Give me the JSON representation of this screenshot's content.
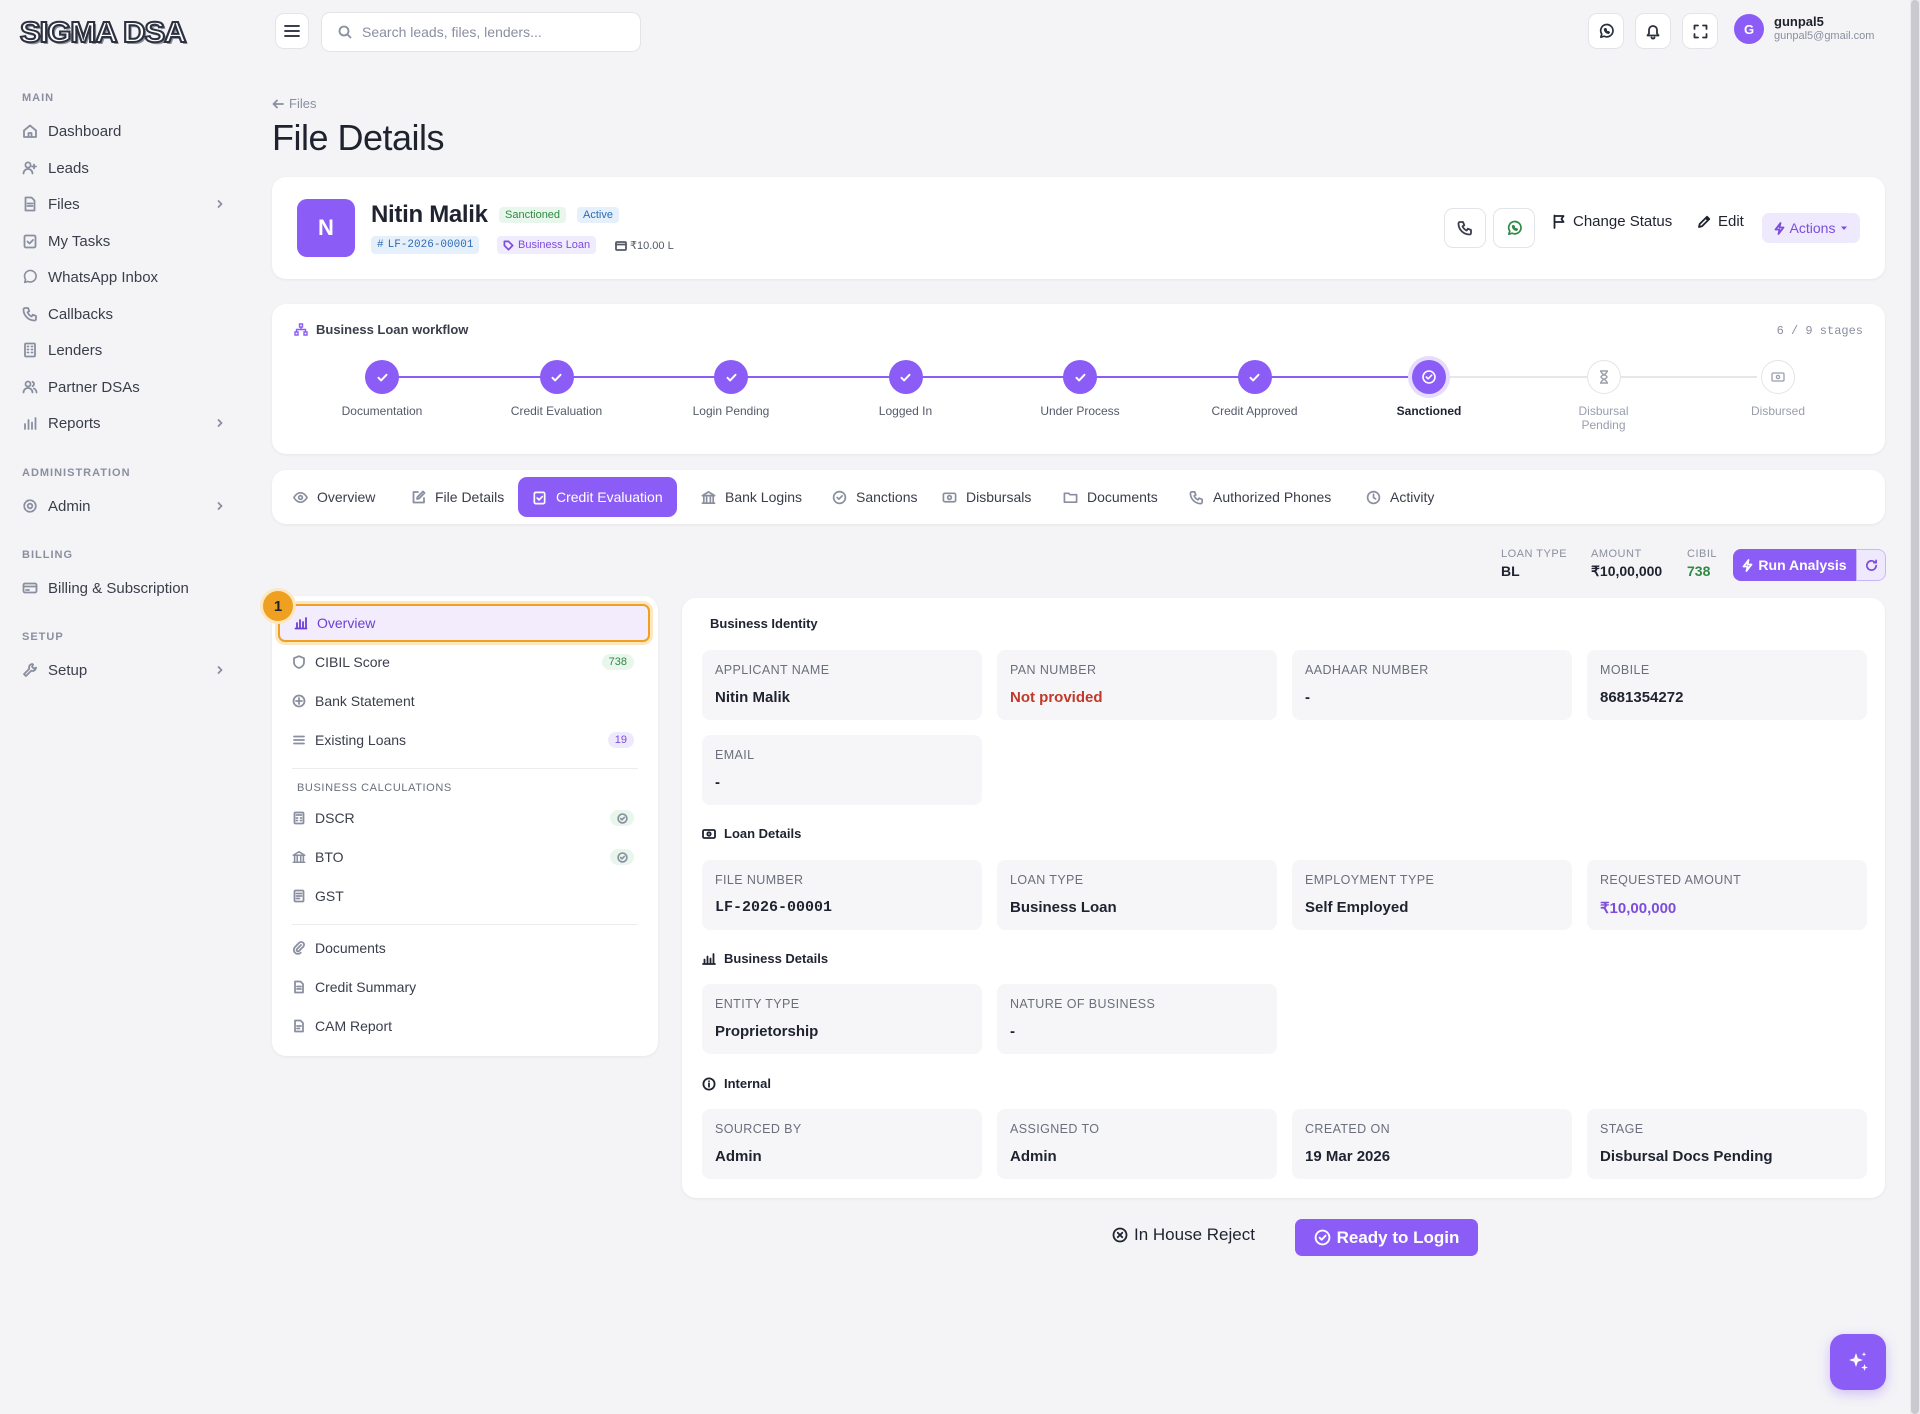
{
  "app": {
    "logo": "SIGMA DSA"
  },
  "topbar": {
    "search_placeholder": "Search leads, files, lenders...",
    "user": {
      "initial": "G",
      "name": "gunpal5",
      "email": "gunpal5@gmail.com"
    }
  },
  "sidebar": {
    "sections": {
      "main": "MAIN",
      "administration": "ADMINISTRATION",
      "billing": "BILLING",
      "setup": "SETUP"
    },
    "items": [
      {
        "label": "Dashboard",
        "icon": "home-icon"
      },
      {
        "label": "Leads",
        "icon": "user-plus-icon"
      },
      {
        "label": "Files",
        "icon": "file-icon"
      },
      {
        "label": "My Tasks",
        "icon": "clipboard-check-icon"
      },
      {
        "label": "WhatsApp Inbox",
        "icon": "whatsapp-icon"
      },
      {
        "label": "Callbacks",
        "icon": "phone-icon"
      },
      {
        "label": "Lenders",
        "icon": "building-icon"
      },
      {
        "label": "Partner DSAs",
        "icon": "users-icon"
      },
      {
        "label": "Reports",
        "icon": "bar-chart-icon"
      },
      {
        "label": "Admin",
        "icon": "gear-icon"
      },
      {
        "label": "Billing & Subscription",
        "icon": "credit-card-icon"
      },
      {
        "label": "Setup",
        "icon": "wrench-icon"
      }
    ]
  },
  "page": {
    "breadcrumb": "Files",
    "title": "File Details"
  },
  "applicant": {
    "initial": "N",
    "name": "Nitin Malik",
    "status_badge": "Sanctioned",
    "state_badge": "Active",
    "file_number": "LF-2026-00001",
    "loan_type": "Business Loan",
    "amount": "₹10.00 L",
    "actions": {
      "change_status": "Change Status",
      "edit": "Edit",
      "actions": "Actions"
    }
  },
  "workflow": {
    "title": "Business Loan workflow",
    "count": "6 / 9 stages",
    "stages": [
      {
        "label": "Documentation",
        "state": "done"
      },
      {
        "label": "Credit Evaluation",
        "state": "done"
      },
      {
        "label": "Login Pending",
        "state": "done"
      },
      {
        "label": "Logged In",
        "state": "done"
      },
      {
        "label": "Under Process",
        "state": "done"
      },
      {
        "label": "Credit Approved",
        "state": "done"
      },
      {
        "label": "Sanctioned",
        "state": "current"
      },
      {
        "label": "Disbursal Pending",
        "state": "todo"
      },
      {
        "label": "Disbursed",
        "state": "todo"
      }
    ]
  },
  "tabs": [
    {
      "label": "Overview",
      "icon": "eye-icon"
    },
    {
      "label": "File Details",
      "icon": "edit-icon"
    },
    {
      "label": "Credit Evaluation",
      "icon": "clipboard-check-icon",
      "active": true
    },
    {
      "label": "Bank Logins",
      "icon": "bank-icon"
    },
    {
      "label": "Sanctions",
      "icon": "check-circle-icon"
    },
    {
      "label": "Disbursals",
      "icon": "cash-icon"
    },
    {
      "label": "Documents",
      "icon": "folder-icon"
    },
    {
      "label": "Authorized Phones",
      "icon": "phone-icon"
    },
    {
      "label": "Activity",
      "icon": "clock-icon"
    }
  ],
  "summary": {
    "loan_type_label": "LOAN TYPE",
    "loan_type": "BL",
    "amount_label": "AMOUNT",
    "amount": "₹10,00,000",
    "cibil_label": "CIBIL",
    "cibil": "738",
    "run_analysis": "Run Analysis"
  },
  "credit_nav": {
    "marker": "1",
    "items": [
      {
        "label": "Overview",
        "icon": "chart-icon",
        "active": true
      },
      {
        "label": "CIBIL Score",
        "icon": "shield-icon",
        "count": "738"
      },
      {
        "label": "Bank Statement",
        "icon": "bank-icon"
      },
      {
        "label": "Existing Loans",
        "icon": "list-icon",
        "count": "19"
      }
    ],
    "calc_section": "BUSINESS CALCULATIONS",
    "calc_items": [
      {
        "label": "DSCR",
        "icon": "calculator-icon"
      },
      {
        "label": "BTO",
        "icon": "building-icon"
      },
      {
        "label": "GST",
        "icon": "receipt-icon"
      }
    ],
    "report_items": [
      {
        "label": "Documents",
        "icon": "paperclip-icon"
      },
      {
        "label": "Credit Summary",
        "icon": "document-icon"
      },
      {
        "label": "CAM Report",
        "icon": "file-icon"
      }
    ]
  },
  "details": {
    "business_identity": {
      "title": "Business Identity",
      "fields": [
        {
          "label": "APPLICANT NAME",
          "value": "Nitin Malik"
        },
        {
          "label": "PAN NUMBER",
          "value": "Not provided"
        },
        {
          "label": "AADHAAR NUMBER",
          "value": "-"
        },
        {
          "label": "MOBILE",
          "value": "8681354272"
        },
        {
          "label": "EMAIL",
          "value": "-"
        }
      ]
    },
    "loan_details": {
      "title": "Loan Details",
      "fields": [
        {
          "label": "FILE NUMBER",
          "value": "LF-2026-00001"
        },
        {
          "label": "LOAN TYPE",
          "value": "Business Loan"
        },
        {
          "label": "EMPLOYMENT TYPE",
          "value": "Self Employed"
        },
        {
          "label": "REQUESTED AMOUNT",
          "value": "₹10,00,000"
        }
      ]
    },
    "business_details": {
      "title": "Business Details",
      "fields": [
        {
          "label": "ENTITY TYPE",
          "value": "Proprietorship"
        },
        {
          "label": "NATURE OF BUSINESS",
          "value": "-"
        }
      ]
    },
    "internal": {
      "title": "Internal",
      "fields": [
        {
          "label": "SOURCED BY",
          "value": "Admin"
        },
        {
          "label": "ASSIGNED TO",
          "value": "Admin"
        },
        {
          "label": "CREATED ON",
          "value": "19 Mar 2026"
        },
        {
          "label": "STAGE",
          "value": "Disbursal Docs Pending"
        }
      ]
    }
  },
  "footer_actions": {
    "reject": "In House Reject",
    "ready": "Ready to Login"
  },
  "colors": {
    "accent": "#8b5cf6",
    "success": "#2f8a45",
    "danger": "#c0392b",
    "highlight": "#f0a020"
  }
}
